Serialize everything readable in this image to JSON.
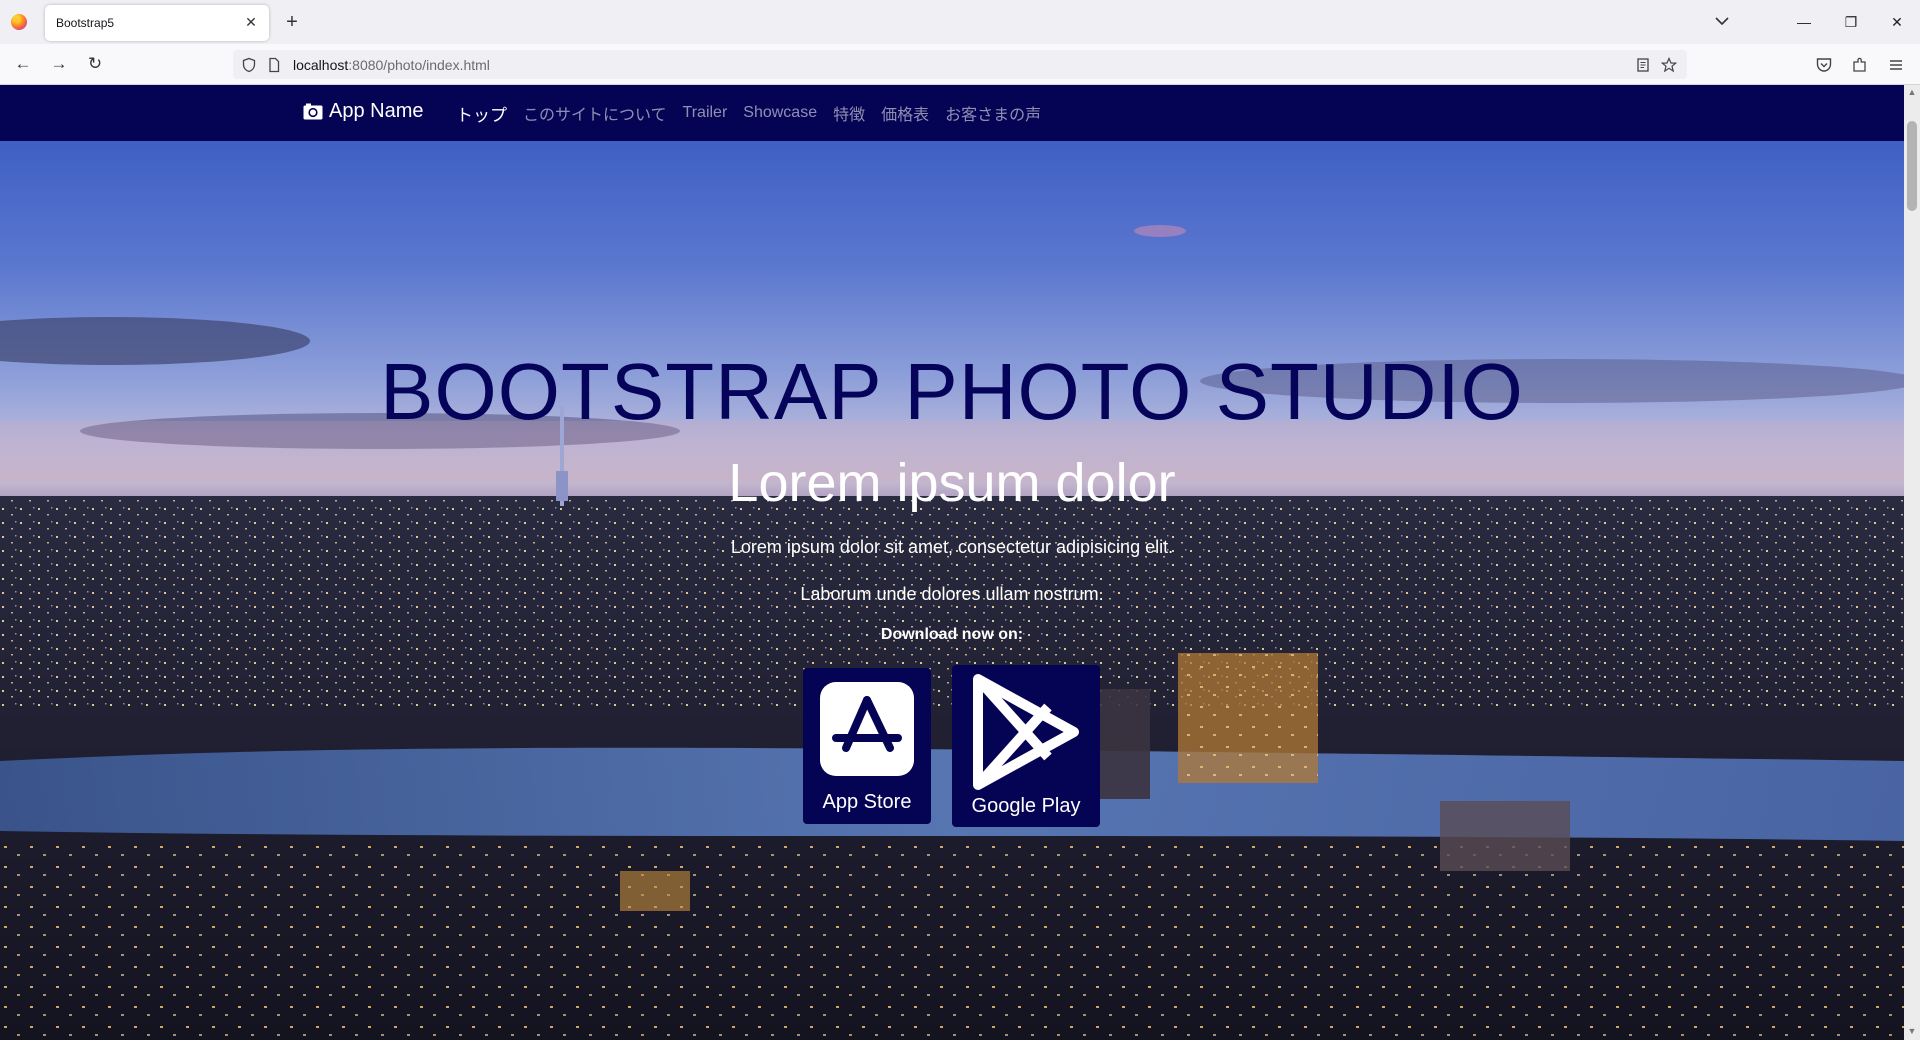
{
  "browser": {
    "tab_title": "Bootstrap5",
    "url_host": "localhost",
    "url_rest": ":8080/photo/index.html"
  },
  "site": {
    "brand": "App Name",
    "menu": [
      {
        "label": "トップ",
        "active": true
      },
      {
        "label": "このサイトについて",
        "active": false
      },
      {
        "label": "Trailer",
        "active": false
      },
      {
        "label": "Showcase",
        "active": false
      },
      {
        "label": "特徴",
        "active": false
      },
      {
        "label": "価格表",
        "active": false
      },
      {
        "label": "お客さまの声",
        "active": false
      }
    ],
    "colors": {
      "nav_bg": "#050354",
      "title": "#06035a"
    }
  },
  "hero": {
    "title": "BOOTSTRAP PHOTO STUDIO",
    "subtitle": "Lorem ipsum dolor",
    "line1": "Lorem ipsum dolor sit amet, consectetur adipisicing elit.",
    "line2": "Laborum unde dolores ullam nostrum.",
    "download_label": "Download now on:",
    "app_store_label": "App Store",
    "google_play_label": "Google Play"
  }
}
